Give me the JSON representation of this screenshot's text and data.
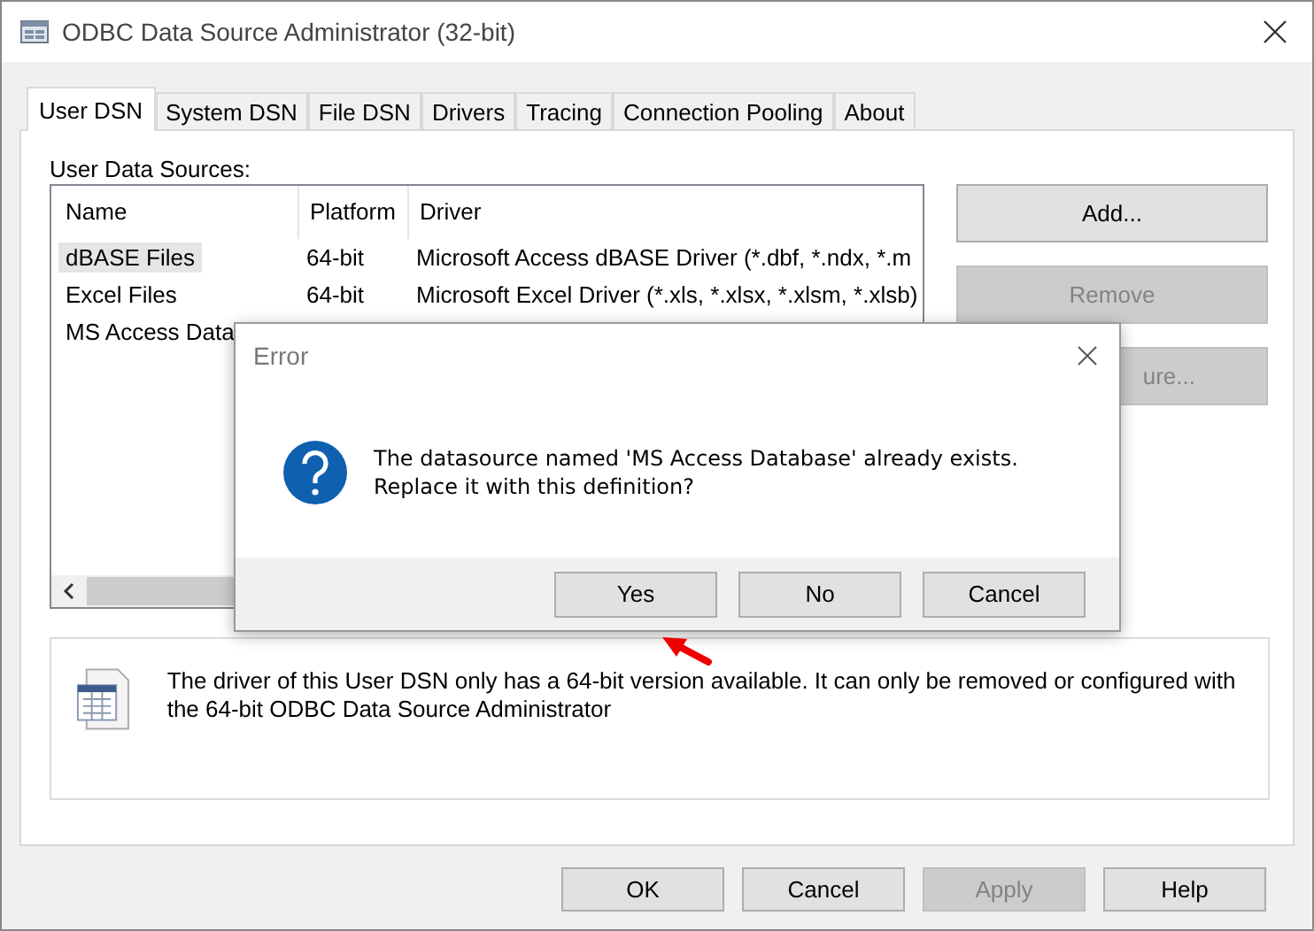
{
  "window": {
    "title": "ODBC Data Source Administrator (32-bit)"
  },
  "tabs": [
    {
      "label": "User DSN",
      "selected": true
    },
    {
      "label": "System DSN",
      "selected": false
    },
    {
      "label": "File DSN",
      "selected": false
    },
    {
      "label": "Drivers",
      "selected": false
    },
    {
      "label": "Tracing",
      "selected": false
    },
    {
      "label": "Connection Pooling",
      "selected": false
    },
    {
      "label": "About",
      "selected": false
    }
  ],
  "sources_label": "User Data Sources:",
  "table": {
    "columns": [
      "Name",
      "Platform",
      "Driver"
    ],
    "rows": [
      {
        "name": "dBASE Files",
        "platform": "64-bit",
        "driver": "Microsoft Access dBASE Driver (*.dbf, *.ndx, *.m",
        "selected": true
      },
      {
        "name": "Excel Files",
        "platform": "64-bit",
        "driver": "Microsoft Excel Driver (*.xls, *.xlsx, *.xlsm, *.xlsb)",
        "selected": false
      },
      {
        "name": "MS Access Data",
        "selected": false
      }
    ]
  },
  "side_buttons": [
    {
      "label": "Add...",
      "disabled": false
    },
    {
      "label": "Remove",
      "disabled": true
    },
    {
      "label": "ure...",
      "disabled": true
    }
  ],
  "info": "The driver of this User DSN only has a 64-bit version available. It can only be removed or configured with the 64-bit ODBC Data Source Administrator",
  "footer_buttons": [
    {
      "label": "OK",
      "disabled": false
    },
    {
      "label": "Cancel",
      "disabled": false
    },
    {
      "label": "Apply",
      "disabled": true
    },
    {
      "label": "Help",
      "disabled": false
    }
  ],
  "dialog": {
    "title": "Error",
    "message": [
      "The datasource named 'MS Access Database' already exists.",
      "Replace it with this definition?"
    ],
    "buttons": [
      "Yes",
      "No",
      "Cancel"
    ]
  }
}
